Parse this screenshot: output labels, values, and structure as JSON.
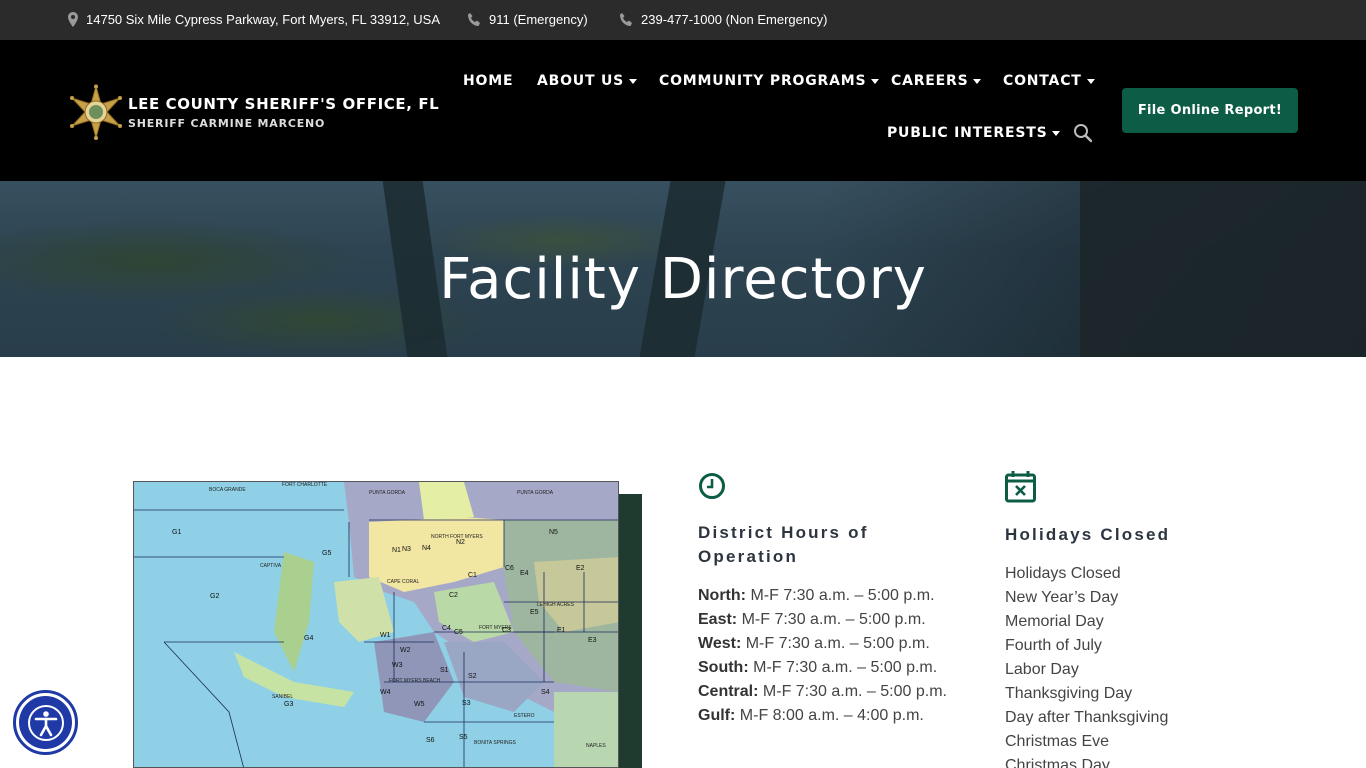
{
  "topbar": {
    "address": "14750 Six Mile Cypress Parkway, Fort Myers, FL 33912, USA",
    "emergency": "911 (Emergency)",
    "non_emergency": "239-477-1000 (Non Emergency)"
  },
  "header": {
    "org_name": "LEE COUNTY SHERIFF'S OFFICE, FL",
    "sheriff": "SHERIFF CARMINE MARCENO",
    "nav": {
      "home": "HOME",
      "about": "ABOUT US",
      "community": "COMMUNITY PROGRAMS",
      "careers": "CAREERS",
      "contact": "CONTACT",
      "public": "PUBLIC INTERESTS"
    },
    "report_button": "File Online Report!"
  },
  "hero": {
    "title": "Facility Directory"
  },
  "map_labels": {
    "fort_charlotte": "FORT CHARLOTTE",
    "boca_grande": "BOCA GRANDE",
    "punta_gorda_west": "PUNTA GORDA",
    "punta_gorda_east": "PUNTA GORDA",
    "north_fort_myers": "NORTH FORT MYERS",
    "cape_coral": "CAPE CORAL",
    "captiva": "CAPTIVA",
    "sanibel": "SANIBEL",
    "fort_myers": "FORT MYERS",
    "fort_myers_beach": "FORT MYERS BEACH",
    "estero": "ESTERO",
    "bonita_springs": "BONITA SPRINGS",
    "naples": "NAPLES",
    "lehigh_acres": "LEHIGH ACRES",
    "districts": [
      "G1",
      "G2",
      "G3",
      "G4",
      "G5",
      "N1",
      "N2",
      "N3",
      "N4",
      "N5",
      "C1",
      "C2",
      "C3",
      "C4",
      "C5",
      "C6",
      "E1",
      "E2",
      "E3",
      "E4",
      "E5",
      "W1",
      "W2",
      "W3",
      "W4",
      "W5",
      "S1",
      "S2",
      "S3",
      "S4",
      "S5",
      "S6"
    ]
  },
  "hours": {
    "title": "District Hours of Operation",
    "rows": [
      {
        "district": "North:",
        "time": "M-F 7:30 a.m. – 5:00 p.m."
      },
      {
        "district": "East:",
        "time": "M-F 7:30 a.m. – 5:00 p.m."
      },
      {
        "district": "West:",
        "time": "M-F 7:30 a.m. – 5:00 p.m."
      },
      {
        "district": "South:",
        "time": "M-F 7:30 a.m. – 5:00 p.m."
      },
      {
        "district": "Central:",
        "time": "M-F 7:30 a.m. – 5:00 p.m."
      },
      {
        "district": "Gulf:",
        "time": "M-F 8:00 a.m. – 4:00 p.m."
      }
    ]
  },
  "holidays": {
    "title": "Holidays Closed",
    "items": [
      "Holidays Closed",
      "New Year’s Day",
      "Memorial Day",
      "Fourth of July",
      "Labor Day",
      "Thanksgiving Day",
      "Day after Thanksgiving",
      "Christmas Eve",
      "Christmas Day"
    ]
  },
  "colors": {
    "accent_green": "#0d5c46",
    "header_bg": "#000000",
    "topbar_bg": "#2b2b2b",
    "a11y_blue": "#1f3aa6"
  }
}
